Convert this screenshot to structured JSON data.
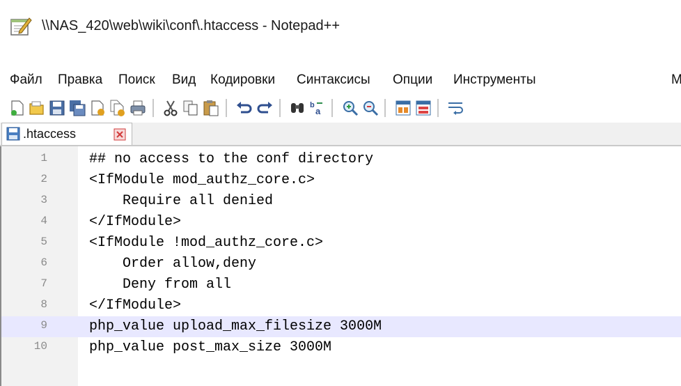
{
  "window": {
    "title": "\\\\NAS_420\\web\\wiki\\conf\\.htaccess - Notepad++"
  },
  "menu": [
    "Файл",
    "Правка",
    "Поиск",
    "Вид",
    "Кодировки",
    "Синтаксисы",
    "Опции",
    "Инструменты",
    "М"
  ],
  "toolbar": {
    "buttons": [
      "new-file",
      "open-file",
      "save",
      "save-all",
      "close",
      "close-all",
      "print",
      "cut",
      "copy",
      "paste",
      "undo",
      "redo",
      "find",
      "replace",
      "zoom-in",
      "zoom-out",
      "sync-vertical",
      "sync-horizontal",
      "word-wrap"
    ]
  },
  "tab": {
    "label": ".htaccess"
  },
  "editor": {
    "current_line": 9,
    "lines": [
      {
        "num": "1",
        "text": "## no access to the conf directory"
      },
      {
        "num": "2",
        "text": "<IfModule mod_authz_core.c>"
      },
      {
        "num": "3",
        "text": "    Require all denied"
      },
      {
        "num": "4",
        "text": "</IfModule>"
      },
      {
        "num": "5",
        "text": "<IfModule !mod_authz_core.c>"
      },
      {
        "num": "6",
        "text": "    Order allow,deny"
      },
      {
        "num": "7",
        "text": "    Deny from all"
      },
      {
        "num": "8",
        "text": "</IfModule>"
      },
      {
        "num": "9",
        "text": "php_value upload_max_filesize 3000M"
      },
      {
        "num": "10",
        "text": "php_value post_max_size 3000M"
      }
    ]
  },
  "colors": {
    "current_line_bg": "#e8e8ff",
    "gutter_bg": "#f2f2f2",
    "line_number": "#8a8a8a"
  }
}
